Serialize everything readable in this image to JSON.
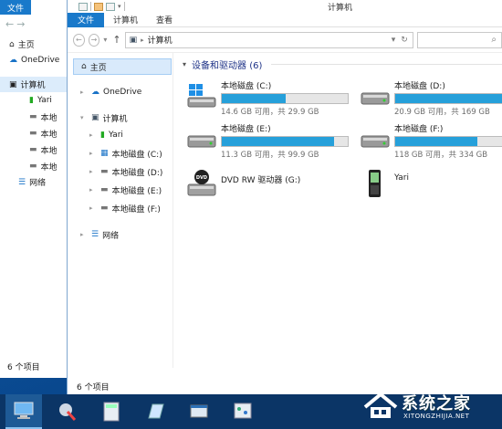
{
  "back_window": {
    "file_tab": "文件",
    "tree": [
      {
        "label": "主页",
        "icon": "home-icon"
      },
      {
        "label": "OneDrive",
        "icon": "cloud-icon"
      },
      {
        "label": "计算机",
        "icon": "computer-icon"
      },
      {
        "label": "Yari",
        "icon": "phone-icon"
      },
      {
        "label": "本地",
        "icon": "drive-icon"
      },
      {
        "label": "本地",
        "icon": "drive-icon"
      },
      {
        "label": "本地",
        "icon": "drive-icon"
      },
      {
        "label": "本地",
        "icon": "drive-icon"
      },
      {
        "label": "网络",
        "icon": "network-icon"
      }
    ],
    "status": "6 个项目"
  },
  "window": {
    "title": "计算机",
    "ribbon_tabs": [
      "文件",
      "计算机",
      "查看"
    ],
    "address": "计算机",
    "nav": [
      {
        "label": "主页",
        "icon": "home-icon"
      },
      {
        "label": "OneDrive",
        "icon": "cloud-icon"
      },
      {
        "label": "计算机",
        "icon": "computer-icon"
      },
      {
        "label": "Yari",
        "icon": "phone-icon"
      },
      {
        "label": "本地磁盘 (C:)",
        "icon": "windows-drive-icon"
      },
      {
        "label": "本地磁盘 (D:)",
        "icon": "drive-icon"
      },
      {
        "label": "本地磁盘 (E:)",
        "icon": "drive-icon"
      },
      {
        "label": "本地磁盘 (F:)",
        "icon": "drive-icon"
      },
      {
        "label": "网络",
        "icon": "network-icon"
      }
    ],
    "group_header": "设备和驱动器 (6)",
    "drives": [
      {
        "name": "本地磁盘 (C:)",
        "info": "14.6 GB 可用，共 29.9 GB",
        "used_fraction": 0.51,
        "icon": "windows-drive-icon"
      },
      {
        "name": "本地磁盘 (D:)",
        "info": "20.9 GB 可用，共 169 GB",
        "used_fraction": 0.88,
        "icon": "drive-icon"
      },
      {
        "name": "本地磁盘 (E:)",
        "info": "11.3 GB 可用，共 99.9 GB",
        "used_fraction": 0.89,
        "icon": "drive-icon"
      },
      {
        "name": "本地磁盘 (F:)",
        "info": "118 GB 可用，共 334 GB",
        "used_fraction": 0.65,
        "icon": "drive-icon"
      }
    ],
    "devices": [
      {
        "name": "DVD RW 驱动器 (G:)",
        "icon": "dvd-drive-icon"
      },
      {
        "name": "Yari",
        "icon": "phone-icon"
      }
    ],
    "status": "6 个项目"
  },
  "watermark": {
    "title": "系统之家",
    "sub": "XITONGZHIJIA.NET"
  }
}
